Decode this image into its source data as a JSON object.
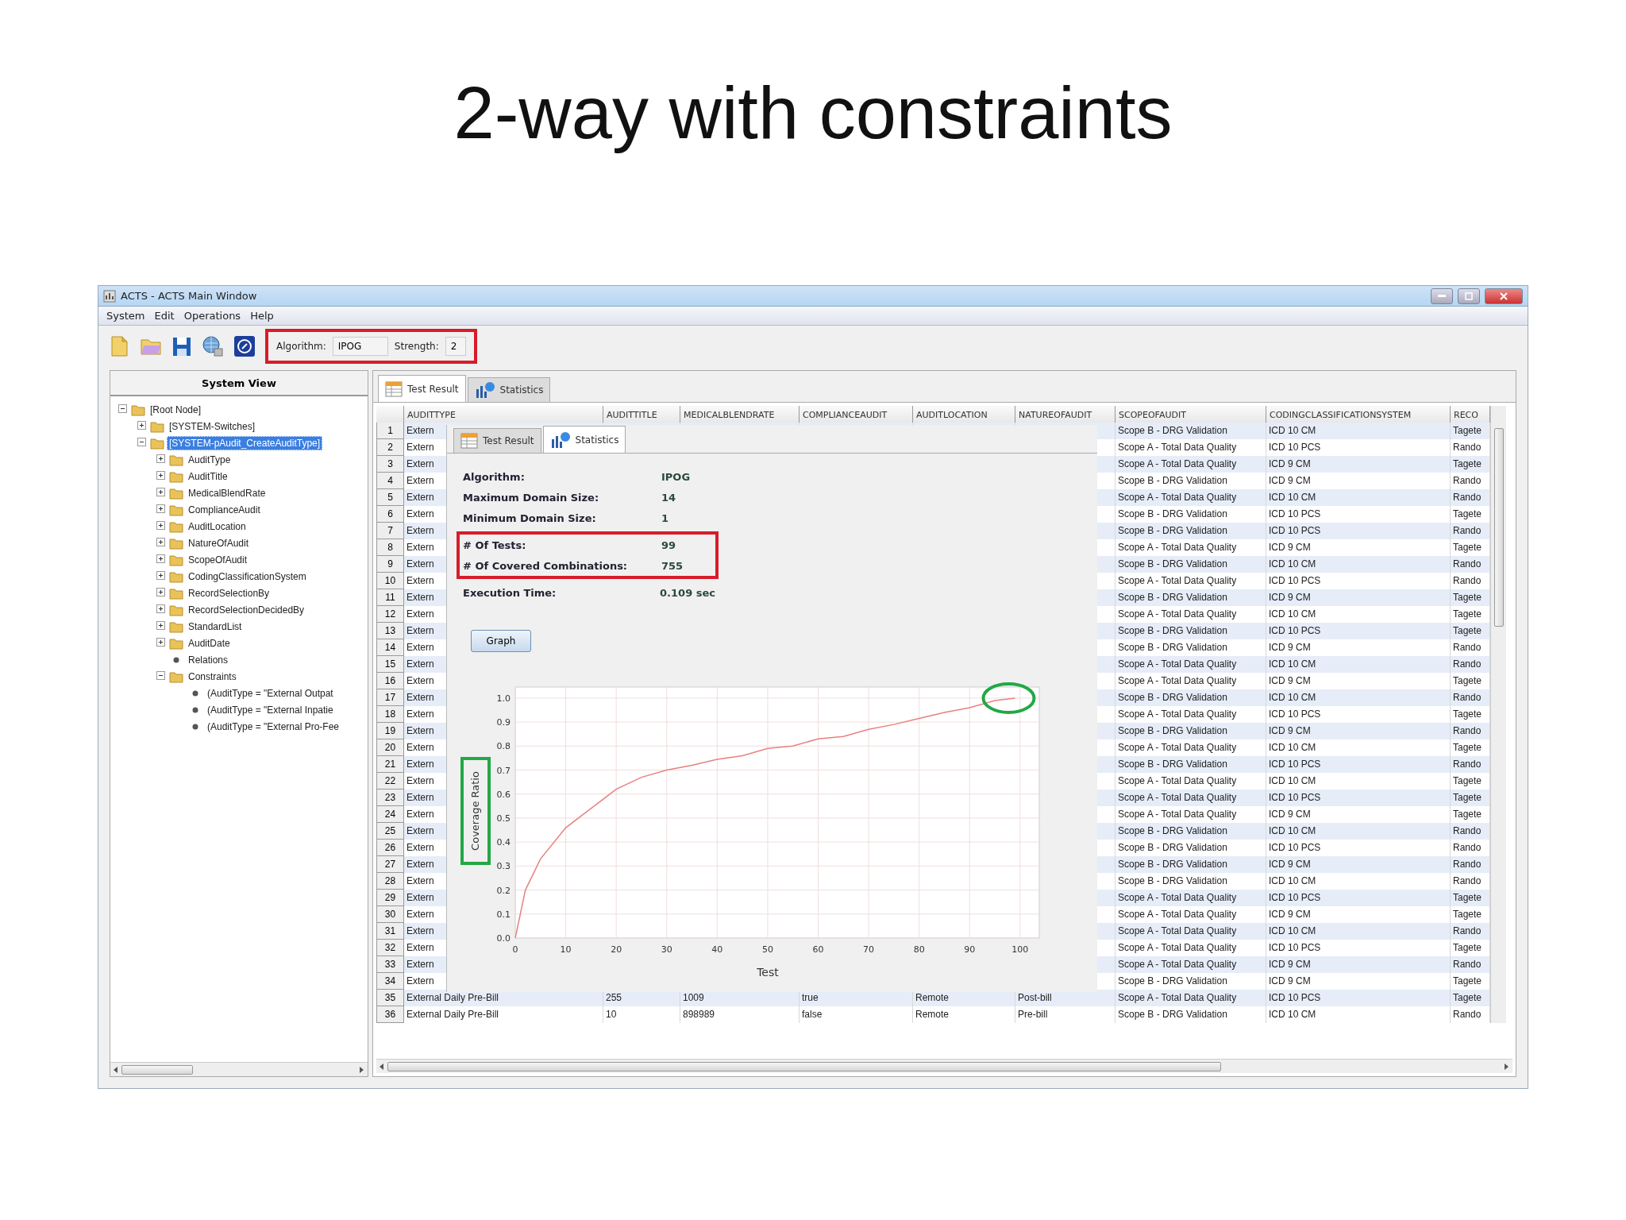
{
  "slide_title": "2-way with constraints",
  "window": {
    "title": "ACTS - ACTS Main Window"
  },
  "menu": [
    "System",
    "Edit",
    "Operations",
    "Help"
  ],
  "toolbar": {
    "highlighted": true,
    "algorithm": {
      "label": "Algorithm:",
      "value": "IPOG"
    },
    "strength": {
      "label": "Strength:",
      "value": "2"
    }
  },
  "system_view": {
    "title": "System View",
    "tree": [
      {
        "label": "[Root Node]",
        "kind": "folder",
        "expanded": true,
        "selected": false,
        "children": [
          {
            "label": "[SYSTEM-Switches]",
            "kind": "folder",
            "expanded": false,
            "selected": false
          },
          {
            "label": "[SYSTEM-pAudit_CreateAuditType]",
            "kind": "folder",
            "expanded": true,
            "selected": true,
            "children": [
              {
                "label": "AuditType",
                "kind": "folder",
                "expanded": false,
                "selected": false
              },
              {
                "label": "AuditTitle",
                "kind": "folder",
                "expanded": false,
                "selected": false
              },
              {
                "label": "MedicalBlendRate",
                "kind": "folder",
                "expanded": false,
                "selected": false
              },
              {
                "label": "ComplianceAudit",
                "kind": "folder",
                "expanded": false,
                "selected": false
              },
              {
                "label": "AuditLocation",
                "kind": "folder",
                "expanded": false,
                "selected": false
              },
              {
                "label": "NatureOfAudit",
                "kind": "folder",
                "expanded": false,
                "selected": false
              },
              {
                "label": "ScopeOfAudit",
                "kind": "folder",
                "expanded": false,
                "selected": false
              },
              {
                "label": "CodingClassificationSystem",
                "kind": "folder",
                "expanded": false,
                "selected": false
              },
              {
                "label": "RecordSelectionBy",
                "kind": "folder",
                "expanded": false,
                "selected": false
              },
              {
                "label": "RecordSelectionDecidedBy",
                "kind": "folder",
                "expanded": false,
                "selected": false
              },
              {
                "label": "StandardList",
                "kind": "folder",
                "expanded": false,
                "selected": false
              },
              {
                "label": "AuditDate",
                "kind": "folder",
                "expanded": false,
                "selected": false
              },
              {
                "label": "Relations",
                "kind": "leaf",
                "selected": false
              },
              {
                "label": "Constraints",
                "kind": "folder",
                "expanded": true,
                "selected": false,
                "children": [
                  {
                    "label": "(AuditType = \"External Outpat",
                    "kind": "leaf",
                    "selected": false
                  },
                  {
                    "label": "(AuditType = \"External Inpatie",
                    "kind": "leaf",
                    "selected": false
                  },
                  {
                    "label": "(AuditType = \"External Pro-Fee",
                    "kind": "leaf",
                    "selected": false
                  }
                ]
              }
            ]
          }
        ]
      }
    ]
  },
  "tabs": [
    {
      "label": "Test Result",
      "selected": true
    },
    {
      "label": "Statistics",
      "selected": false
    }
  ],
  "table": {
    "columns": [
      "AUDITTYPE",
      "AUDITTITLE",
      "MEDICALBLENDRATE",
      "COMPLIANCEAUDIT",
      "AUDITLOCATION",
      "NATUREOFAUDIT",
      "SCOPEOFAUDIT",
      "CODINGCLASSIFICATIONSYSTEM",
      "RECO"
    ],
    "rows": [
      {
        "kind": "covered",
        "number": "1",
        "cells": [
          "Extern",
          "Scope B - DRG Validation",
          "ICD 10 CM",
          "Tagete"
        ]
      },
      {
        "kind": "covered",
        "number": "2",
        "cells": [
          "Extern",
          "Scope A - Total Data Quality",
          "ICD 10 PCS",
          "Rando"
        ]
      },
      {
        "kind": "covered",
        "number": "3",
        "cells": [
          "Extern",
          "Scope A - Total Data Quality",
          "ICD 9 CM",
          "Tagete"
        ]
      },
      {
        "kind": "covered",
        "number": "4",
        "cells": [
          "Extern",
          "Scope B - DRG Validation",
          "ICD 9 CM",
          "Rando"
        ]
      },
      {
        "kind": "covered",
        "number": "5",
        "cells": [
          "Extern",
          "Scope A - Total Data Quality",
          "ICD 10 CM",
          "Rando"
        ]
      },
      {
        "kind": "covered",
        "number": "6",
        "cells": [
          "Extern",
          "Scope B - DRG Validation",
          "ICD 10 PCS",
          "Tagete"
        ]
      },
      {
        "kind": "covered",
        "number": "7",
        "cells": [
          "Extern",
          "Scope B - DRG Validation",
          "ICD 10 PCS",
          "Rando"
        ]
      },
      {
        "kind": "covered",
        "number": "8",
        "cells": [
          "Extern",
          "Scope A - Total Data Quality",
          "ICD 9 CM",
          "Tagete"
        ]
      },
      {
        "kind": "covered",
        "number": "9",
        "cells": [
          "Extern",
          "Scope B - DRG Validation",
          "ICD 10 CM",
          "Rando"
        ]
      },
      {
        "kind": "covered",
        "number": "10",
        "cells": [
          "Extern",
          "Scope A - Total Data Quality",
          "ICD 10 PCS",
          "Rando"
        ]
      },
      {
        "kind": "covered",
        "number": "11",
        "cells": [
          "Extern",
          "Scope B - DRG Validation",
          "ICD 9 CM",
          "Tagete"
        ]
      },
      {
        "kind": "covered",
        "number": "12",
        "cells": [
          "Extern",
          "Scope A - Total Data Quality",
          "ICD 10 CM",
          "Tagete"
        ]
      },
      {
        "kind": "covered",
        "number": "13",
        "cells": [
          "Extern",
          "Scope B - DRG Validation",
          "ICD 10 PCS",
          "Tagete"
        ]
      },
      {
        "kind": "covered",
        "number": "14",
        "cells": [
          "Extern",
          "Scope B - DRG Validation",
          "ICD 9 CM",
          "Rando"
        ]
      },
      {
        "kind": "covered",
        "number": "15",
        "cells": [
          "Extern",
          "Scope A - Total Data Quality",
          "ICD 10 CM",
          "Rando"
        ]
      },
      {
        "kind": "covered",
        "number": "16",
        "cells": [
          "Extern",
          "Scope A - Total Data Quality",
          "ICD 9 CM",
          "Tagete"
        ]
      },
      {
        "kind": "covered",
        "number": "17",
        "cells": [
          "Extern",
          "Scope B - DRG Validation",
          "ICD 10 CM",
          "Rando"
        ]
      },
      {
        "kind": "covered",
        "number": "18",
        "cells": [
          "Extern",
          "Scope A - Total Data Quality",
          "ICD 10 PCS",
          "Tagete"
        ]
      },
      {
        "kind": "covered",
        "number": "19",
        "cells": [
          "Extern",
          "Scope B - DRG Validation",
          "ICD 9 CM",
          "Rando"
        ]
      },
      {
        "kind": "covered",
        "number": "20",
        "cells": [
          "Extern",
          "Scope A - Total Data Quality",
          "ICD 10 CM",
          "Tagete"
        ]
      },
      {
        "kind": "covered",
        "number": "21",
        "cells": [
          "Extern",
          "Scope B - DRG Validation",
          "ICD 10 PCS",
          "Rando"
        ]
      },
      {
        "kind": "covered",
        "number": "22",
        "cells": [
          "Extern",
          "Scope A - Total Data Quality",
          "ICD 10 CM",
          "Tagete"
        ]
      },
      {
        "kind": "covered",
        "number": "23",
        "cells": [
          "Extern",
          "Scope A - Total Data Quality",
          "ICD 10 PCS",
          "Tagete"
        ]
      },
      {
        "kind": "covered",
        "number": "24",
        "cells": [
          "Extern",
          "Scope A - Total Data Quality",
          "ICD 9 CM",
          "Tagete"
        ]
      },
      {
        "kind": "covered",
        "number": "25",
        "cells": [
          "Extern",
          "Scope B - DRG Validation",
          "ICD 10 CM",
          "Rando"
        ]
      },
      {
        "kind": "covered",
        "number": "26",
        "cells": [
          "Extern",
          "Scope B - DRG Validation",
          "ICD 10 PCS",
          "Rando"
        ]
      },
      {
        "kind": "covered",
        "number": "27",
        "cells": [
          "Extern",
          "Scope B - DRG Validation",
          "ICD 9 CM",
          "Rando"
        ]
      },
      {
        "kind": "covered",
        "number": "28",
        "cells": [
          "Extern",
          "Scope B - DRG Validation",
          "ICD 10 CM",
          "Rando"
        ]
      },
      {
        "kind": "covered",
        "number": "29",
        "cells": [
          "Extern",
          "Scope A - Total Data Quality",
          "ICD 10 PCS",
          "Tagete"
        ]
      },
      {
        "kind": "covered",
        "number": "30",
        "cells": [
          "Extern",
          "Scope A - Total Data Quality",
          "ICD 9 CM",
          "Tagete"
        ]
      },
      {
        "kind": "covered",
        "number": "31",
        "cells": [
          "Extern",
          "Scope A - Total Data Quality",
          "ICD 10 CM",
          "Rando"
        ]
      },
      {
        "kind": "covered",
        "number": "32",
        "cells": [
          "Extern",
          "Scope A - Total Data Quality",
          "ICD 10 PCS",
          "Tagete"
        ]
      },
      {
        "kind": "covered",
        "number": "33",
        "cells": [
          "Extern",
          "Scope A - Total Data Quality",
          "ICD 9 CM",
          "Rando"
        ]
      },
      {
        "kind": "covered",
        "number": "34",
        "cells": [
          "Extern",
          "Scope B - DRG Validation",
          "ICD 9 CM",
          "Tagete"
        ]
      },
      {
        "kind": "full",
        "number": "35",
        "cells": [
          "External Daily Pre-Bill",
          "255",
          "1009",
          "true",
          "Remote",
          "Post-bill",
          "Scope A - Total Data Quality",
          "ICD 10 PCS",
          "Tagete"
        ]
      },
      {
        "kind": "full",
        "number": "36",
        "cells": [
          "External Daily Pre-Bill",
          "10",
          "898989",
          "false",
          "Remote",
          "Pre-bill",
          "Scope B - DRG Validation",
          "ICD 10 CM",
          "Rando"
        ]
      }
    ]
  },
  "statistics": {
    "tabs": [
      {
        "label": "Test Result",
        "selected": false
      },
      {
        "label": "Statistics",
        "selected": true
      }
    ],
    "rows": [
      {
        "label": "Algorithm:",
        "value": "IPOG",
        "highlighted": false
      },
      {
        "label": "Maximum Domain Size:",
        "value": "14",
        "highlighted": false
      },
      {
        "label": "Minimum Domain Size:",
        "value": "1",
        "highlighted": false
      },
      {
        "label": "# Of Tests:",
        "value": "99",
        "highlighted": true
      },
      {
        "label": "# Of Covered Combinations:",
        "value": "755",
        "highlighted": true
      },
      {
        "label": "Execution Time:",
        "value": "0.109 sec",
        "highlighted": false
      }
    ],
    "graph_button": "Graph",
    "chart_data": {
      "type": "line",
      "xlabel": "Test",
      "ylabel": "Coverage Ratio",
      "xlim": [
        0,
        103.8
      ],
      "ylim": [
        0,
        1.046
      ],
      "grid": true,
      "xticks": [
        0,
        10,
        20,
        30,
        40,
        50,
        60,
        70,
        80,
        90,
        100
      ],
      "yticks": [
        {
          "value": 0,
          "label": "0.0"
        },
        {
          "value": 0.1,
          "label": "0.1"
        },
        {
          "value": 0.2,
          "label": "0.2"
        },
        {
          "value": 0.3,
          "label": "0.3"
        },
        {
          "value": 0.4,
          "label": "0.4"
        },
        {
          "value": 0.5,
          "label": "0.5"
        },
        {
          "value": 0.6,
          "label": "0.6"
        },
        {
          "value": 0.7,
          "label": "0.7"
        },
        {
          "value": 0.8,
          "label": "0.8"
        },
        {
          "value": 0.9,
          "label": "0.9"
        },
        {
          "value": 1,
          "label": "1.0"
        }
      ],
      "x": [
        0,
        2,
        5,
        10,
        15,
        20,
        25,
        30,
        35,
        40,
        45,
        50,
        55,
        60,
        65,
        70,
        75,
        80,
        85,
        90,
        95,
        99
      ],
      "series": [
        {
          "color": "#e88080",
          "values": [
            0,
            0.2,
            0.33,
            0.46,
            0.54,
            0.62,
            0.67,
            0.7,
            0.72,
            0.745,
            0.76,
            0.79,
            0.8,
            0.83,
            0.84,
            0.87,
            0.89,
            0.915,
            0.94,
            0.96,
            0.99,
            1.0
          ]
        }
      ]
    },
    "ylabel_highlighted": true,
    "end_point_highlighted": true
  }
}
